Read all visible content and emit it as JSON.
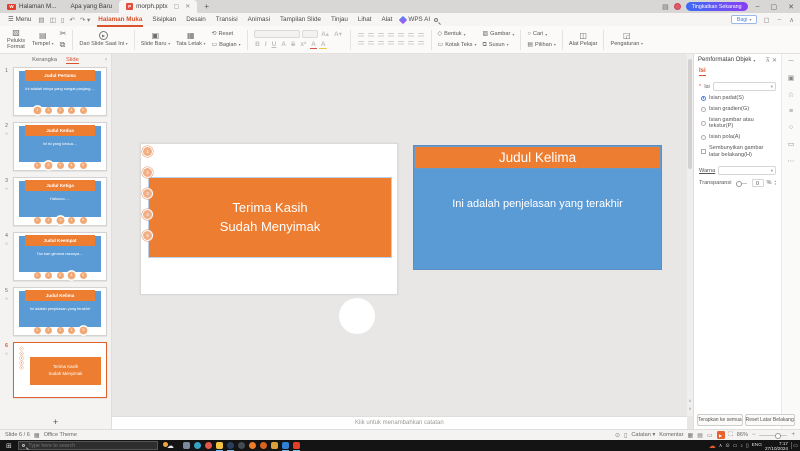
{
  "colors": {
    "accent_orange": "#E8622D",
    "shape_orange": "#ED7D31",
    "shape_blue": "#5B9BD5",
    "dot_salmon": "#F2AE84"
  },
  "titlebar": {
    "home_tab": "Halaman M...",
    "whats_new_tab": "Apa yang Baru",
    "doc_tab": "morph.pptx",
    "upgrade_label": "Tingkatkan Sekarang"
  },
  "menubar": {
    "menu_label": "Menu",
    "tabs": [
      "Halaman Muka",
      "Sisipkan",
      "Desain",
      "Transisi",
      "Animasi",
      "Tampilan Slide",
      "Tinjau",
      "Lihat",
      "Alat"
    ],
    "active_tab": "Halaman Muka",
    "wps_ai_label": "WPS AI",
    "share_label": "Bagi"
  },
  "toolbar": {
    "format_painter": "Pelukis Format",
    "paste": "Tempel",
    "from_current_slide": "Dari Slide Saat Ini",
    "new_slide": "Slide Baru",
    "layout": "Tata Letak",
    "reset": "Reset",
    "section": "Bagian",
    "shapes": "Bentuk",
    "text_box": "Kotak Teks",
    "picture": "Gambar",
    "arrange": "Susun",
    "find": "Cari",
    "selection": "Pilihan",
    "learning_tools": "Alat Pelajar",
    "settings": "Pengaturan"
  },
  "icons": {
    "bold": "B",
    "italic": "I",
    "underline": "U",
    "shadow": "A",
    "strike": "S",
    "superscript": "x²",
    "font_color": "A",
    "highlight": "A",
    "grow_font": "A▴",
    "shrink_font": "A▾"
  },
  "slides_panel": {
    "tab_outline": "Kerangka",
    "tab_slide": "Slide",
    "add_slide": "+",
    "dots": [
      "1",
      "2",
      "3",
      "4",
      "5"
    ],
    "slides": [
      {
        "num": "1",
        "title": "Judul Pertama",
        "body": "Ini adalah isinya yang sangat panjang....",
        "active_dot": 1,
        "starred": false,
        "selected": false
      },
      {
        "num": "2",
        "title": "Judul Kedua",
        "body": "Ini isi yang kedua....",
        "active_dot": 2,
        "starred": true,
        "selected": false
      },
      {
        "num": "3",
        "title": "Judul Ketiga",
        "body": "Haloooo.....",
        "active_dot": 3,
        "starred": true,
        "selected": false
      },
      {
        "num": "4",
        "title": "Judul Keempat",
        "body": "Tau kan gimana rasanya....",
        "active_dot": 4,
        "starred": true,
        "selected": false
      },
      {
        "num": "5",
        "title": "Judul Kelima",
        "body": "Ini adalah penjelasan yang terakhir",
        "active_dot": 5,
        "starred": true,
        "selected": false
      },
      {
        "num": "6",
        "title": "Terima Kasih\nSudah Menyimak",
        "body": "",
        "active_dot": 0,
        "starred": true,
        "selected": true
      }
    ]
  },
  "canvas": {
    "slide_dots": [
      "1",
      "2",
      "3",
      "4",
      "5"
    ],
    "thanks_text": "Terima Kasih\nSudah Menyimak",
    "offslide_title": "Judul Kelima",
    "offslide_body": "Ini adalah penjelasan yang terakhir",
    "notes_placeholder": "Klik untuk menambahkan catatan"
  },
  "properties_panel": {
    "title": "Pemformatan Objek",
    "tab_fill": "Isi",
    "fill_label": "Isi",
    "options": [
      {
        "type": "radio",
        "label": "Isian padat(S)",
        "selected": true
      },
      {
        "type": "radio",
        "label": "Isian gradien(G)",
        "selected": false
      },
      {
        "type": "radio",
        "label": "Isian gambar atau tekstur(P)",
        "selected": false
      },
      {
        "type": "radio",
        "label": "Isian pola(A)",
        "selected": false
      },
      {
        "type": "checkbox",
        "label": "Sembunyikan gambar latar belakang(H)",
        "selected": false
      }
    ],
    "color_label": "Warna",
    "transparency_label": "Transparansi",
    "transparency_value": "0",
    "percent": "%",
    "apply_all": "Terapkan ke semua",
    "reset_bg": "Reset Latar Belakang"
  },
  "statusbar": {
    "slide_info": "Slide 6 / 6",
    "theme": "Office Theme",
    "notes": "Catatan",
    "comments": "Komentar",
    "zoom_level": "86%"
  },
  "taskbar": {
    "search_placeholder": "Type here to search",
    "lang": "ENG",
    "time": "7:17",
    "date": "27/10/2024",
    "apps": [
      {
        "name": "app-pin",
        "color": "#7a8aa0",
        "shape": "square",
        "active": false
      },
      {
        "name": "app-edge",
        "color": "#35a3c9",
        "shape": "circle",
        "active": false
      },
      {
        "name": "app-chrome",
        "color": "#e2574c",
        "shape": "circle",
        "active": false
      },
      {
        "name": "app-explorer",
        "color": "#f3c243",
        "shape": "square",
        "active": true
      },
      {
        "name": "app-steam",
        "color": "#2a3f5f",
        "shape": "circle",
        "active": true
      },
      {
        "name": "app-media",
        "color": "#444b52",
        "shape": "circle",
        "active": false
      },
      {
        "name": "app-firefox",
        "color": "#f07c2a",
        "shape": "circle",
        "active": false
      },
      {
        "name": "app-game",
        "color": "#d8641f",
        "shape": "circle",
        "active": false
      },
      {
        "name": "app-security",
        "color": "#d9a03a",
        "shape": "square",
        "active": false
      },
      {
        "name": "app-vscode",
        "color": "#2f7fd4",
        "shape": "square",
        "active": true
      },
      {
        "name": "app-wps",
        "color": "#e33e2b",
        "shape": "square",
        "active": true
      }
    ]
  }
}
